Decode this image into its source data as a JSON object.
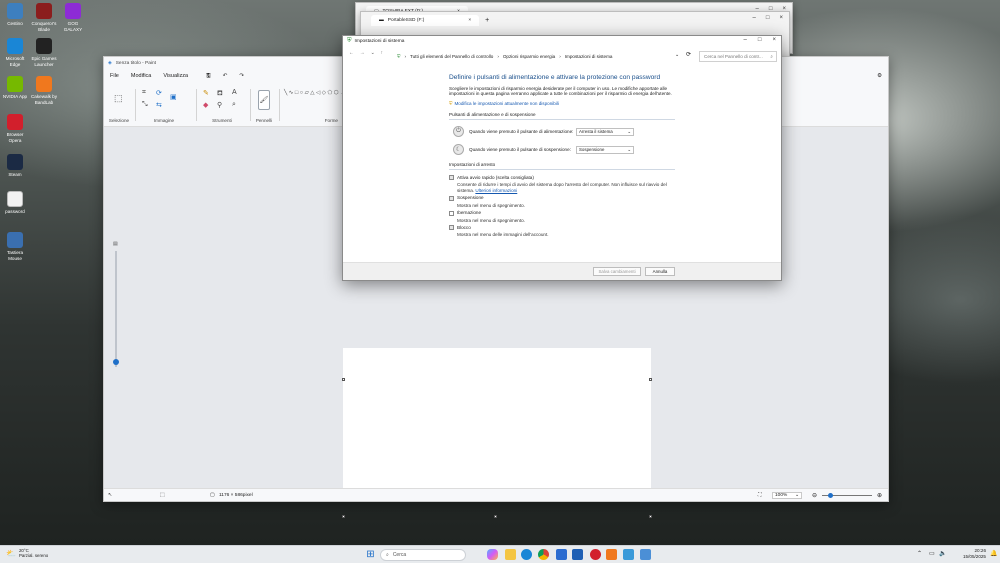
{
  "desktop": {
    "icons": [
      {
        "label": "Cestino",
        "icon": "recycle-bin-icon",
        "color": "#3d7fbf"
      },
      {
        "label": "Conqueror's Blade",
        "icon": "game-icon",
        "color": "#8b1d1d"
      },
      {
        "label": "GOG GALAXY",
        "icon": "gog-galaxy-icon",
        "color": "#8d2bd6"
      },
      {
        "label": "Microsoft Edge",
        "icon": "edge-icon",
        "color": "#1a86d6"
      },
      {
        "label": "Epic Games Launcher",
        "icon": "epic-games-icon",
        "color": "#222222"
      },
      {
        "label": "NVIDIA App",
        "icon": "nvidia-icon",
        "color": "#76b900"
      },
      {
        "label": "Cakewalk by BandLab",
        "icon": "cakewalk-icon",
        "color": "#f0781e"
      },
      {
        "label": "Browser Opera",
        "icon": "opera-icon",
        "color": "#d21f2c"
      },
      {
        "label": "Steam",
        "icon": "steam-icon",
        "color": "#1b2a44"
      },
      {
        "label": "password",
        "icon": "text-file-icon",
        "color": "#f2f2f2"
      },
      {
        "label": "Tastiera Mouse",
        "icon": "keyboard-mouse-icon",
        "color": "#3a6fb0"
      }
    ]
  },
  "explorer_back": {
    "tab1": "TOSHIBA EXT (D:)",
    "tab2": "PortableSSD (F:)"
  },
  "paint": {
    "title": "Senza titolo - Paint",
    "menu": {
      "file": "File",
      "edit": "Modifica",
      "view": "Visualizza"
    },
    "groups": {
      "selection": "Selezione",
      "image": "Immagine",
      "tools": "Strumenti",
      "brushes": "Pennelli",
      "shapes": "Forme"
    },
    "status": {
      "canvas_size": "1176 × 586pixel",
      "zoom": "100%"
    },
    "vertical_zoom_level": 0.04
  },
  "dialog": {
    "title": "Impostazioni di sistema",
    "breadcrumb": [
      "Tutti gli elementi del Pannello di controllo",
      "Opzioni risparmio energia",
      "Impostazioni di sistema"
    ],
    "search_placeholder": "Cerca nel Pannello di contr...",
    "heading": "Definire i pulsanti di alimentazione e attivare la protezione con password",
    "intro": "Scegliere le impostazioni di risparmio energia desiderate per il computer in uso. Le modifiche apportate alle impostazioni in questa pagina verranno applicate a tutte le combinazioni per il risparmio di energia dell'utente.",
    "change_link": "Modifica le impostazioni attualmente non disponibili",
    "power_section": "Pulsanti di alimentazione e di sospensione",
    "power_button_label": "Quando viene premuto il pulsante di alimentazione:",
    "power_button_value": "Arresta il sistema",
    "sleep_button_label": "Quando viene premuto il pulsante di sospensione:",
    "sleep_button_value": "Sospensione",
    "shutdown_section": "Impostazioni di arresto",
    "fast_startup": "Attiva avvio rapido (scelta consigliata)",
    "fast_startup_desc": "Consente di ridurre i tempi di avvio del sistema dopo l'arresto del computer. Non influisce sul riavvio del sistema.",
    "more_info": "Ulteriori informazioni",
    "sleep": "Sospensione",
    "sleep_desc": "Mostra nel menu di spegnimento.",
    "hibernate": "Ibernazione",
    "hibernate_desc": "Mostra nel menu di spegnimento.",
    "lock": "Blocco",
    "lock_desc": "Mostra nel menu delle immagini dell'account.",
    "save_button": "Salva cambiamenti",
    "cancel_button": "Annulla"
  },
  "taskbar": {
    "weather_temp": "20°C",
    "weather_desc": "Parzial. sereno",
    "search_label": "Cerca",
    "time": "20:26",
    "date": "15/05/2025"
  },
  "colors": {
    "accent": "#1f6fc8",
    "heading_blue": "#1a4f8b",
    "link_blue": "#1558b0"
  }
}
